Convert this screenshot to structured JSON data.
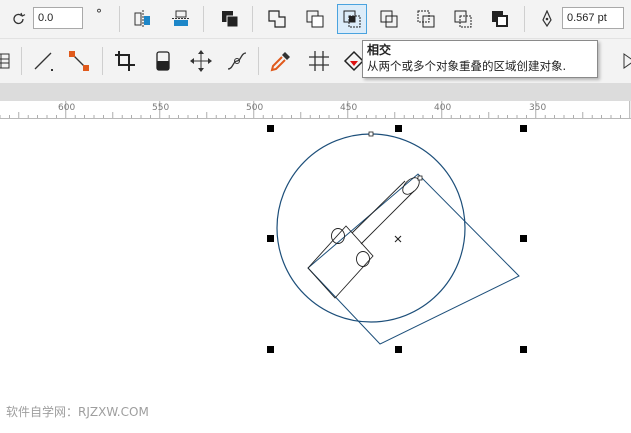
{
  "toolbar_top": {
    "rotation_value": "0.0",
    "degree_symbol": "°",
    "outline_width": "0.567 pt",
    "icons": [
      "rotate-icon",
      "align-icon",
      "distribute-icon",
      "combine-icon",
      "weld-icon",
      "trim-icon",
      "intersect-icon",
      "simplify-icon",
      "front-minus-back-icon",
      "back-minus-front-icon",
      "create-boundary-icon",
      "pen-outline-icon"
    ]
  },
  "toolbar_second": {
    "icons": [
      "page-icon",
      "line-tool-icon",
      "connector-icon",
      "crop-icon",
      "eraser-icon",
      "transform-icon",
      "curve-icon",
      "eyedropper-icon",
      "grid-icon",
      "fill-icon"
    ]
  },
  "tooltip": {
    "title": "相交",
    "description": "从两个或多个对象重叠的区域创建对象."
  },
  "ruler": {
    "labels": [
      "600",
      "550",
      "500",
      "450",
      "400",
      "350"
    ]
  },
  "watermark": "软件自学网：RJZXW.COM",
  "colors": {
    "outline_blue": "#1d4f7a",
    "active_border": "#4aa3df",
    "toolbar_bg": "#f3f3f3"
  }
}
